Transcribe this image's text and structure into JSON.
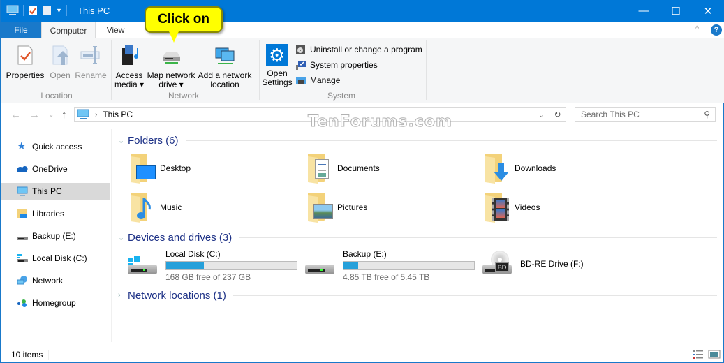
{
  "window": {
    "title": "This PC",
    "controls": {
      "minimize": "—",
      "maximize": "☐",
      "close": "✕"
    }
  },
  "ribbon_tabs": [
    {
      "label": "File"
    },
    {
      "label": "Computer",
      "active": true
    },
    {
      "label": "View"
    }
  ],
  "ribbon": {
    "groups": [
      {
        "label": "Location",
        "buttons": [
          {
            "label": "Properties",
            "enabled": true
          },
          {
            "label": "Open",
            "enabled": false
          },
          {
            "label": "Rename",
            "enabled": false
          }
        ]
      },
      {
        "label": "Network",
        "buttons": [
          {
            "label": "Access media",
            "line1": "Access",
            "line2": "media ▾"
          },
          {
            "label": "Map network drive",
            "line1": "Map network",
            "line2": "drive ▾"
          },
          {
            "label": "Add a network location",
            "line1": "Add a network",
            "line2": "location"
          }
        ]
      },
      {
        "label": "System",
        "buttons": [
          {
            "label": "Open Settings",
            "line1": "Open",
            "line2": "Settings"
          }
        ],
        "small_items": [
          {
            "label": "Uninstall or change a program"
          },
          {
            "label": "System properties"
          },
          {
            "label": "Manage"
          }
        ]
      }
    ],
    "collapse_icon": "^",
    "help_icon": "?"
  },
  "callout": {
    "text": "Click on"
  },
  "address_bar": {
    "path": [
      "This PC"
    ],
    "search_placeholder": "Search This PC"
  },
  "watermark": "TenForums.com",
  "sidebar": {
    "items": [
      {
        "label": "Quick access",
        "icon": "star-icon"
      },
      {
        "label": "OneDrive",
        "icon": "cloud-icon"
      },
      {
        "label": "This PC",
        "icon": "monitor-icon",
        "selected": true
      },
      {
        "label": "Libraries",
        "icon": "library-icon"
      },
      {
        "label": "Backup (E:)",
        "icon": "drive-icon"
      },
      {
        "label": "Local Disk (C:)",
        "icon": "windows-drive-icon"
      },
      {
        "label": "Network",
        "icon": "network-icon"
      },
      {
        "label": "Homegroup",
        "icon": "homegroup-icon"
      }
    ]
  },
  "content": {
    "folders_header": "Folders (6)",
    "folders": [
      {
        "label": "Desktop"
      },
      {
        "label": "Documents"
      },
      {
        "label": "Downloads"
      },
      {
        "label": "Music"
      },
      {
        "label": "Pictures"
      },
      {
        "label": "Videos"
      }
    ],
    "devices_header": "Devices and drives (3)",
    "drives": [
      {
        "label": "Local Disk (C:)",
        "free": "168 GB free of 237 GB",
        "used_fraction": 0.29
      },
      {
        "label": "Backup (E:)",
        "free": "4.85 TB free of 5.45 TB",
        "used_fraction": 0.11
      },
      {
        "label": "BD-RE Drive (F:)",
        "badge": "BD"
      }
    ],
    "network_header": "Network locations (1)"
  },
  "status": {
    "items_count": "10 items"
  },
  "colors": {
    "accent": "#0078d7",
    "group_header": "#1e3287",
    "bar_fill": "#26a0da",
    "callout": "#ffff00"
  }
}
